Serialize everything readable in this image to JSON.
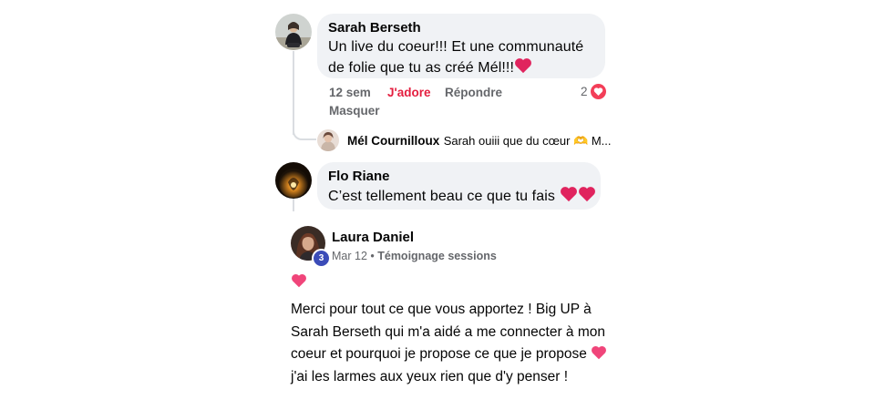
{
  "comments": [
    {
      "author": "Sarah Berseth",
      "text_line1": "Un live du coeur!!! Et une communauté",
      "text_line2": "de folie que tu as créé Mél!!!",
      "time": "12 sem",
      "love_label": "J'adore",
      "reply_label": "Répondre",
      "hide_label": "Masquer",
      "reaction_count": "2",
      "reply_preview": {
        "author": "Mél Cournilloux",
        "text": "Sarah ouiii que du cœur 🫶 M..."
      }
    },
    {
      "author": "Flo Riane",
      "text": "C’est tellement beau ce que tu fais"
    }
  ],
  "post": {
    "author": "Laura Daniel",
    "badge": "3",
    "date": "Mar 12",
    "separator": " • ",
    "category": "Témoignage sessions",
    "body_line1": "Merci pour tout ce que vous apportez ! Big UP à",
    "body_line2": "Sarah Berseth qui m'a aidé a me connecter à mon",
    "body_line3": "coeur et pourquoi je propose ce que je propose",
    "body_line4": "j'ai les larmes aux yeux rien que d'y penser !"
  },
  "colors": {
    "bubble": "#f0f2f5",
    "love": "#e41e3f",
    "heart": "#e0245e",
    "badge": "#3b4cb8",
    "muted": "#65676b"
  }
}
